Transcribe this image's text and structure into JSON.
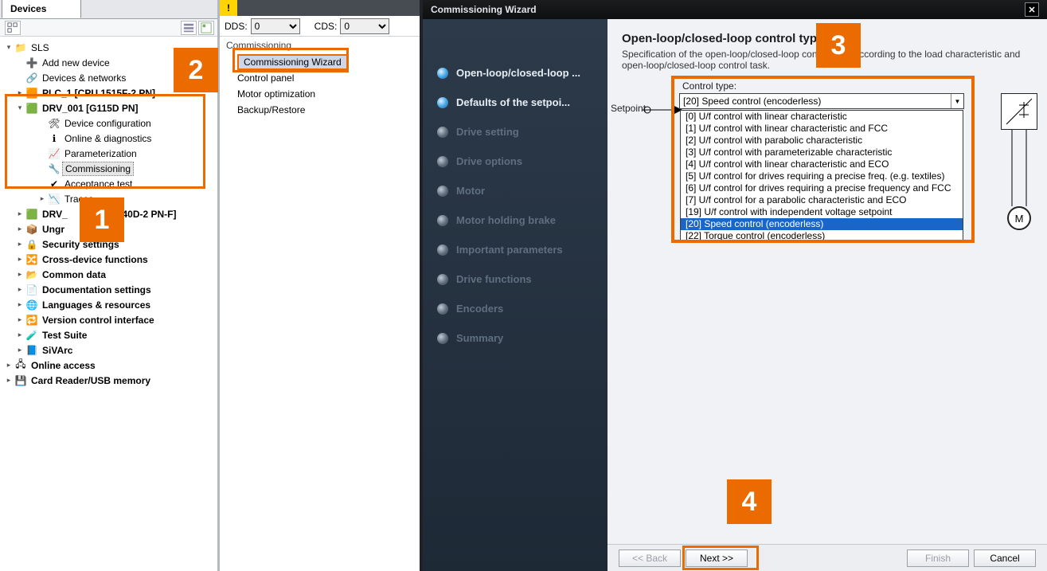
{
  "tabs": {
    "devices": "Devices"
  },
  "dds": {
    "dds_label": "DDS:",
    "dds_value": "0",
    "cds_label": "CDS:",
    "cds_value": "0"
  },
  "commissioning": {
    "header": "Commissioning",
    "items": [
      "Commissioning Wizard",
      "Control panel",
      "Motor optimization",
      "Backup/Restore"
    ]
  },
  "tree": {
    "root": "SLS",
    "add_device": "Add new device",
    "devices_networks": "Devices & networks",
    "plc": "PLC_1 [CPU 1515F-2 PN]",
    "drv001": "DRV_001 [G115D PN]",
    "drv001_children": {
      "dev_cfg": "Device configuration",
      "online_diag": "Online & diagnostics",
      "params": "Parameterization",
      "commissioning": "Commissioning",
      "accept_test": "Acceptance test",
      "traces": "Traces"
    },
    "drv_other": "DRV_",
    "drv_other_tail": "U240D-2 PN-F]",
    "ungr": "Ungr",
    "security": "Security settings",
    "cross_dev": "Cross-device functions",
    "common_data": "Common data",
    "doc_settings": "Documentation settings",
    "lang_res": "Languages & resources",
    "vcs": "Version control interface",
    "test_suite": "Test Suite",
    "sivarc": "SiVArc",
    "online_access": "Online access",
    "card_reader": "Card Reader/USB memory"
  },
  "wizard": {
    "title": "Commissioning Wizard",
    "steps": [
      "Open-loop/closed-loop ...",
      "Defaults of the setpoi...",
      "Drive setting",
      "Drive options",
      "Motor",
      "Motor holding brake",
      "Important parameters",
      "Drive functions",
      "Encoders",
      "Summary"
    ],
    "page_title": "Open-loop/closed-loop control type",
    "page_desc": "Specification of the open-loop/closed-loop control type according to the load characteristic and open-loop/closed-loop control task.",
    "setpoint_label": "Setpoint",
    "control_type_label": "Control type:",
    "control_type_selected": "[20] Speed control (encoderless)",
    "control_type_options": [
      "[0] U/f control with linear characteristic",
      "[1] U/f control with linear characteristic and FCC",
      "[2] U/f control with parabolic characteristic",
      "[3] U/f control with parameterizable characteristic",
      "[4] U/f control with linear characteristic and ECO",
      "[5] U/f control for drives requiring a precise freq. (e.g. textiles)",
      "[6] U/f control for drives requiring a precise frequency and FCC",
      "[7] U/f control for a parabolic characteristic and ECO",
      "[19] U/f control with independent voltage setpoint",
      "[20] Speed control (encoderless)",
      "[22] Torque control (encoderless)"
    ],
    "buttons": {
      "back": "<< Back",
      "next": "Next >>",
      "finish": "Finish",
      "cancel": "Cancel"
    },
    "motor_label": "M"
  },
  "callouts": {
    "c1": "1",
    "c2": "2",
    "c3": "3",
    "c4": "4"
  }
}
